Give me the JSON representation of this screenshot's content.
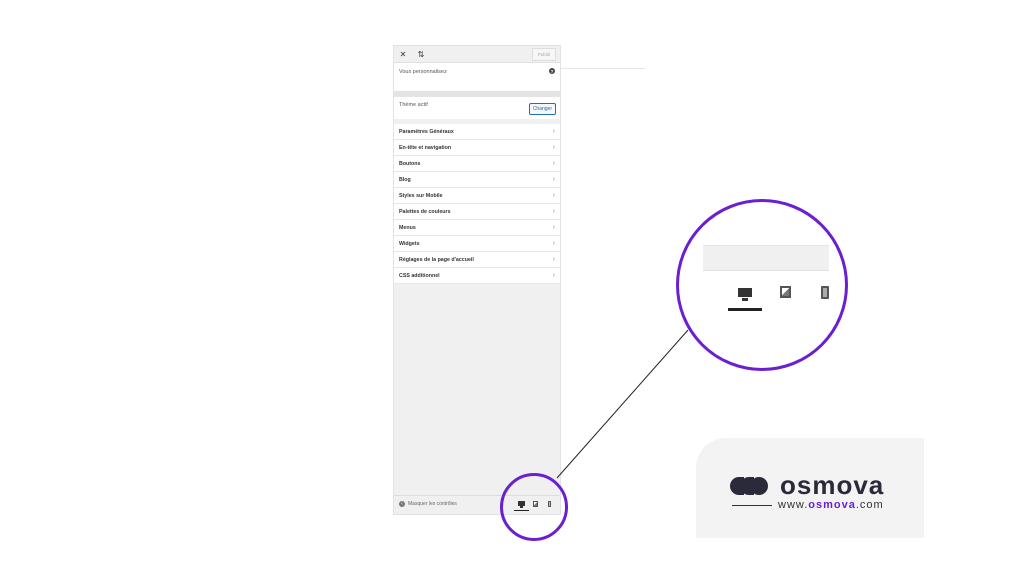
{
  "topbar": {
    "close_icon": "close-icon",
    "reorder_icon": "sort-arrows-icon",
    "publish_label": "Publié"
  },
  "info": {
    "text": "Vous personnalisez",
    "help_icon": "help-icon"
  },
  "theme": {
    "label": "Thème actif",
    "change_label": "Changer"
  },
  "menu": {
    "items": [
      {
        "label": "Paramètres Généraux"
      },
      {
        "label": "En-tête et navigation"
      },
      {
        "label": "Boutons"
      },
      {
        "label": "Blog"
      },
      {
        "label": "Styles sur Mobile"
      },
      {
        "label": "Palettes de couleurs"
      },
      {
        "label": "Menus"
      },
      {
        "label": "Widgets"
      },
      {
        "label": "Réglages de la page d'accueil"
      },
      {
        "label": "CSS additionnel"
      }
    ]
  },
  "footer": {
    "hide_controls": "Masquer les contrôles",
    "devices": [
      "desktop-icon",
      "tablet-icon",
      "mobile-icon"
    ],
    "active_device": "desktop"
  },
  "brand": {
    "name": "osmova",
    "url_prefix": "www.",
    "url_highlight": "osmova",
    "url_suffix": ".com"
  },
  "colors": {
    "accent_purple": "#6a1fd0",
    "wp_blue": "#2271b1",
    "brand_dark": "#2a2a3a"
  }
}
